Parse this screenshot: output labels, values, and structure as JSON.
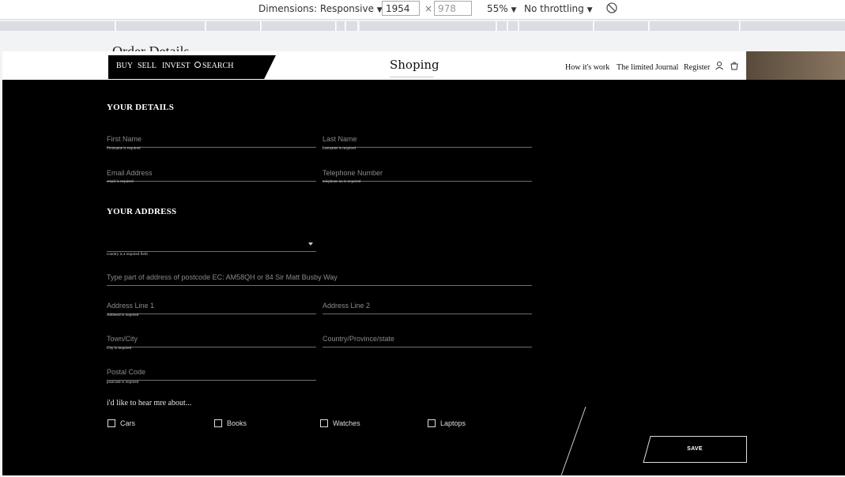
{
  "devtools": {
    "dimensions_label": "Dimensions: Responsive",
    "width_value": "1954",
    "height_value": "978",
    "zoom": "55%",
    "throttling": "No throttling"
  },
  "page": {
    "order_heading": "Order Details",
    "nav": {
      "buy": "BUY",
      "sell": "SELL",
      "invest": "INVEST",
      "search": "SEARCH"
    },
    "brand": "Shoping",
    "header_links": {
      "how": "How it's work",
      "journal": "The limited Journal",
      "register": "Register"
    }
  },
  "form": {
    "details_title": "YOUR DETAILS",
    "first_name": {
      "placeholder": "First Name",
      "error": "Firstname is required"
    },
    "last_name": {
      "placeholder": "Last Name",
      "error": "Lastname is required"
    },
    "email": {
      "placeholder": "Email Address",
      "error": "email is required"
    },
    "telephone": {
      "placeholder": "Telephone Number",
      "error": "telephone no is required"
    },
    "address_title": "YOUR ADDRESS",
    "country": {
      "value": "",
      "error": "country is a required field"
    },
    "lookup": {
      "placeholder": "Type part of address of postcode EC: AM58QH or 84 Sir Matt Busby Way"
    },
    "address1": {
      "placeholder": "Address Line 1",
      "error": "Addressl is required"
    },
    "address2": {
      "placeholder": "Address Line 2"
    },
    "town": {
      "placeholder": "Town/City",
      "error": "City is required"
    },
    "state": {
      "placeholder": "Country/Province/state"
    },
    "postal": {
      "placeholder": "Postal Code",
      "error": "postcode is required"
    },
    "interest_prompt": "i'd like to hear mre about...",
    "interests": [
      "Cars",
      "Books",
      "Watches",
      "Laptops"
    ],
    "save_label": "SAVE"
  },
  "colors": {
    "background": "#000000",
    "header": "#ffffff",
    "text": "#ffffff"
  }
}
